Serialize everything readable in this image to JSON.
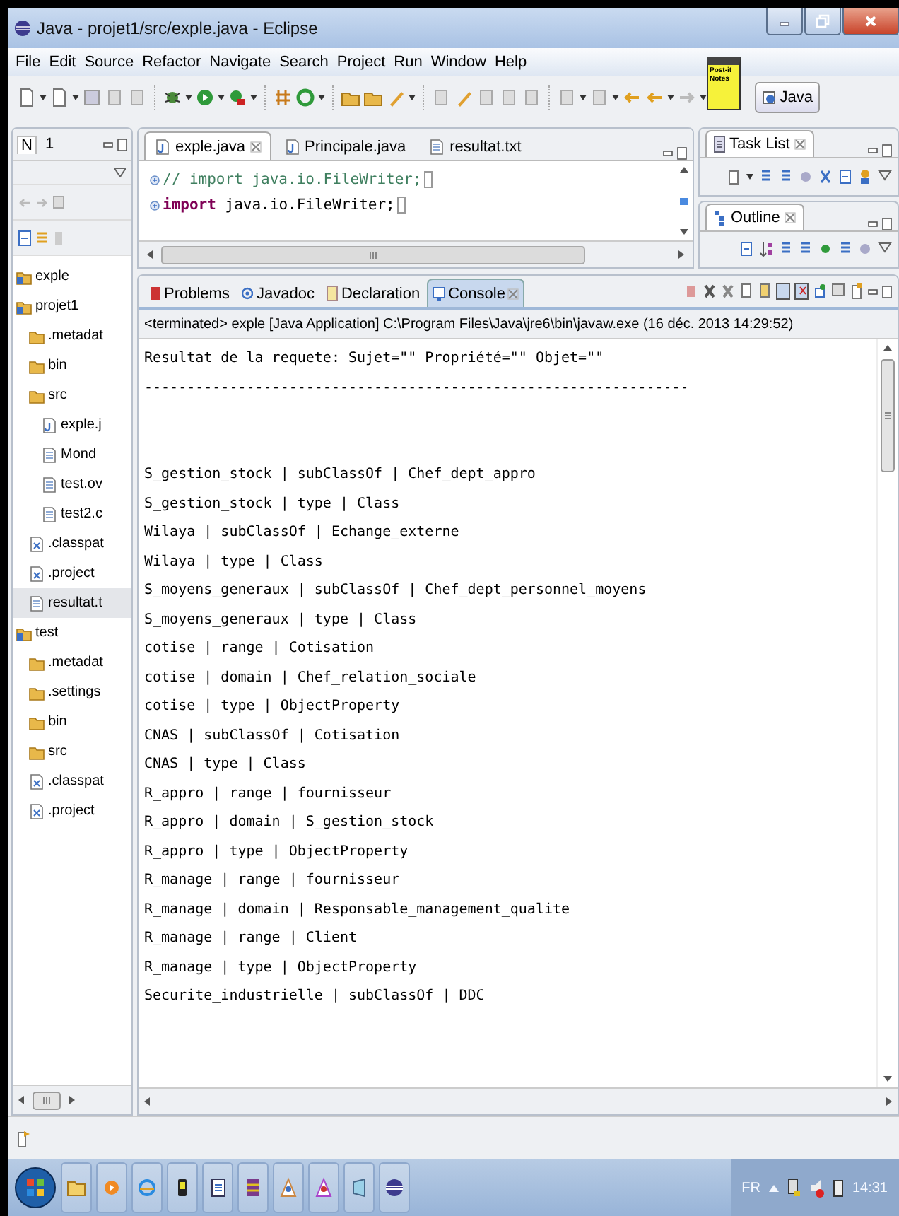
{
  "window": {
    "title": "Java - projet1/src/exple.java - Eclipse"
  },
  "menu": [
    "File",
    "Edit",
    "Source",
    "Refactor",
    "Navigate",
    "Search",
    "Project",
    "Run",
    "Window",
    "Help"
  ],
  "perspective": {
    "label": "Java",
    "selected": true
  },
  "sticky_note": {
    "text": "Post-it Notes"
  },
  "explorer": {
    "tabs": [
      {
        "label": "N",
        "selected": true
      },
      {
        "label": "1",
        "selected": false
      }
    ],
    "tree": [
      {
        "kind": "project",
        "label": "exple",
        "selected": false
      },
      {
        "kind": "project",
        "label": "projet1",
        "selected": false,
        "children": [
          {
            "kind": "folder",
            "label": ".metadat",
            "selected": false
          },
          {
            "kind": "folder",
            "label": "bin",
            "selected": false
          },
          {
            "kind": "folder",
            "label": "src",
            "selected": false,
            "children": [
              {
                "kind": "java",
                "label": "exple.j",
                "selected": false
              },
              {
                "kind": "text",
                "label": "Mond",
                "selected": false
              },
              {
                "kind": "text",
                "label": "test.ov",
                "selected": false
              },
              {
                "kind": "text",
                "label": "test2.c",
                "selected": false
              }
            ]
          },
          {
            "kind": "xml",
            "label": ".classpat",
            "selected": false
          },
          {
            "kind": "xml",
            "label": ".project",
            "selected": false
          },
          {
            "kind": "text",
            "label": "resultat.t",
            "selected": true
          }
        ]
      },
      {
        "kind": "project",
        "label": "test",
        "selected": false,
        "children": [
          {
            "kind": "folder",
            "label": ".metadat",
            "selected": false
          },
          {
            "kind": "folder",
            "label": ".settings",
            "selected": false
          },
          {
            "kind": "folder",
            "label": "bin",
            "selected": false
          },
          {
            "kind": "folder",
            "label": "src",
            "selected": false
          },
          {
            "kind": "xml",
            "label": ".classpat",
            "selected": false
          },
          {
            "kind": "xml",
            "label": ".project",
            "selected": false
          }
        ]
      }
    ]
  },
  "editor": {
    "tabs": [
      {
        "label": "exple.java",
        "kind": "java",
        "selected": true
      },
      {
        "label": "Principale.java",
        "kind": "java",
        "selected": false
      },
      {
        "label": "resultat.txt",
        "kind": "text",
        "selected": false
      }
    ],
    "lines": [
      {
        "kind": "comment",
        "text": "// import java.io.FileWriter;"
      },
      {
        "kind": "import",
        "keyword": "import",
        "text": " java.io.FileWriter;"
      }
    ]
  },
  "task_list": {
    "title": "Task List"
  },
  "outline": {
    "title": "Outline"
  },
  "console": {
    "tabs": [
      {
        "label": "Problems",
        "selected": false
      },
      {
        "label": "Javadoc",
        "selected": false
      },
      {
        "label": "Declaration",
        "selected": false
      },
      {
        "label": "Console",
        "selected": true
      }
    ],
    "status": "<terminated> exple [Java Application] C:\\Program Files\\Java\\jre6\\bin\\javaw.exe (16 déc. 2013 14:29:52)",
    "lines": [
      "Resultat de la requete: Sujet=\"\" Propriété=\"\" Objet=\"\"",
      "----------------------------------------------------------------",
      "S_gestion_stock | subClassOf | Chef_dept_appro",
      "S_gestion_stock | type | Class",
      "Wilaya | subClassOf | Echange_externe",
      "Wilaya | type | Class",
      "S_moyens_generaux | subClassOf | Chef_dept_personnel_moyens",
      "S_moyens_generaux | type | Class",
      "cotise | range | Cotisation",
      "cotise | domain | Chef_relation_sociale",
      "cotise | type | ObjectProperty",
      "CNAS | subClassOf | Cotisation",
      "CNAS | type | Class",
      "R_appro | range | fournisseur",
      "R_appro | domain | S_gestion_stock",
      "R_appro | type | ObjectProperty",
      "R_manage | range | fournisseur",
      "R_manage | domain | Responsable_management_qualite",
      "R_manage | range | Client",
      "R_manage | type | ObjectProperty",
      "Securite_industrielle | subClassOf | DDC"
    ]
  },
  "taskbar": {
    "language": "FR",
    "clock": "14:31"
  }
}
